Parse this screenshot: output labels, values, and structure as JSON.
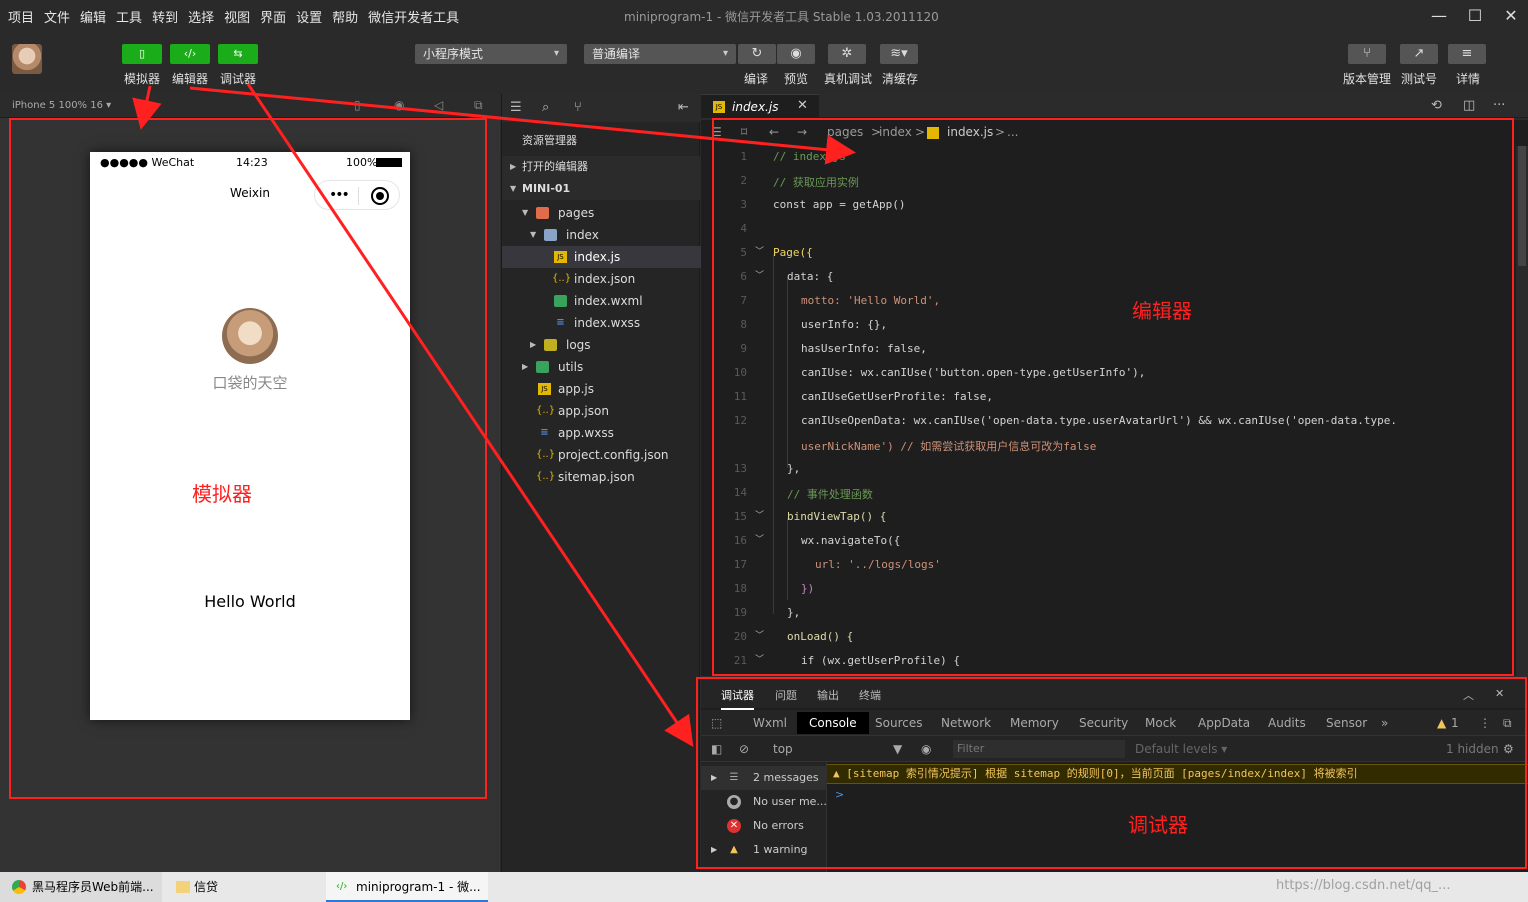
{
  "menubar": {
    "items": [
      "项目",
      "文件",
      "编辑",
      "工具",
      "转到",
      "选择",
      "视图",
      "界面",
      "设置",
      "帮助",
      "微信开发者工具"
    ],
    "title": "miniprogram-1 - 微信开发者工具 Stable 1.03.2011120"
  },
  "toolbar": {
    "left_labels": [
      "模拟器",
      "编辑器",
      "调试器"
    ],
    "mode_select": "小程序模式",
    "compile_select": "普通编译",
    "mid_labels": [
      "编译",
      "预览",
      "真机调试",
      "清缓存"
    ],
    "right_labels": [
      "版本管理",
      "测试号",
      "详情"
    ]
  },
  "simulator": {
    "device": "iPhone 5 100% 16 ▾",
    "status_left": "●●●●● WeChat",
    "time": "14:23",
    "battery": "100%",
    "nav_title": "Weixin",
    "nickname": "口袋的天空",
    "hello": "Hello World"
  },
  "explorer": {
    "title": "资源管理器",
    "open_editors": "打开的编辑器",
    "project": "MINI-01",
    "tree": [
      "pages",
      "index",
      "index.js",
      "index.json",
      "index.wxml",
      "index.wxss",
      "logs",
      "utils",
      "app.js",
      "app.json",
      "app.wxss",
      "project.config.json",
      "sitemap.json"
    ]
  },
  "editor": {
    "tab": "index.js",
    "breadcrumb": [
      "pages",
      ">",
      "index",
      ">",
      "index.js",
      ">",
      "..."
    ]
  },
  "code_lines": [
    {
      "n": "1",
      "text": "// index.js"
    },
    {
      "n": "2",
      "text": "// 获取应用实例"
    },
    {
      "n": "3",
      "text": "const app = getApp()"
    },
    {
      "n": "4",
      "text": ""
    },
    {
      "n": "5",
      "text": "Page({"
    },
    {
      "n": "6",
      "text": "data: {"
    },
    {
      "n": "7",
      "text": "motto: 'Hello World',"
    },
    {
      "n": "8",
      "text": "userInfo: {},"
    },
    {
      "n": "9",
      "text": "hasUserInfo: false,"
    },
    {
      "n": "10",
      "text": "canIUse: wx.canIUse('button.open-type.getUserInfo'),"
    },
    {
      "n": "11",
      "text": "canIUseGetUserProfile: false,"
    },
    {
      "n": "12",
      "text": "canIUseOpenData: wx.canIUse('open-data.type.userAvatarUrl') && wx.canIUse('open-data.type."
    },
    {
      "n": "",
      "text": "userNickName') // 如需尝试获取用户信息可改为false"
    },
    {
      "n": "13",
      "text": "},"
    },
    {
      "n": "14",
      "text": "// 事件处理函数"
    },
    {
      "n": "15",
      "text": "bindViewTap() {"
    },
    {
      "n": "16",
      "text": "wx.navigateTo({"
    },
    {
      "n": "17",
      "text": "url: '../logs/logs'"
    },
    {
      "n": "18",
      "text": "})"
    },
    {
      "n": "19",
      "text": "},"
    },
    {
      "n": "20",
      "text": "onLoad() {"
    },
    {
      "n": "21",
      "text": "if (wx.getUserProfile) {"
    }
  ],
  "debugger": {
    "tabs": [
      "调试器",
      "问题",
      "输出",
      "终端"
    ],
    "panels": [
      "Wxml",
      "Console",
      "Sources",
      "Network",
      "Memory",
      "Security",
      "Mock",
      "AppData",
      "Audits",
      "Sensor"
    ],
    "warn_count": "1",
    "context": "top",
    "filter_placeholder": "Filter",
    "levels": "Default levels ▾",
    "hidden": "1 hidden",
    "side": [
      "2 messages",
      "No user me...",
      "No errors",
      "1 warning"
    ],
    "warning_text": "▲ [sitemap 索引情况提示] 根据 sitemap 的规则[0]，当前页面 [pages/index/index] 将被索引",
    "prompt": ">"
  },
  "annotations": {
    "sim": "模拟器",
    "editor": "编辑器",
    "debugger": "调试器"
  },
  "taskbar": {
    "items": [
      "黑马程序员Web前端...",
      "信贷",
      "miniprogram-1 - 微..."
    ],
    "watermark": "https://blog.csdn.net/qq_..."
  }
}
